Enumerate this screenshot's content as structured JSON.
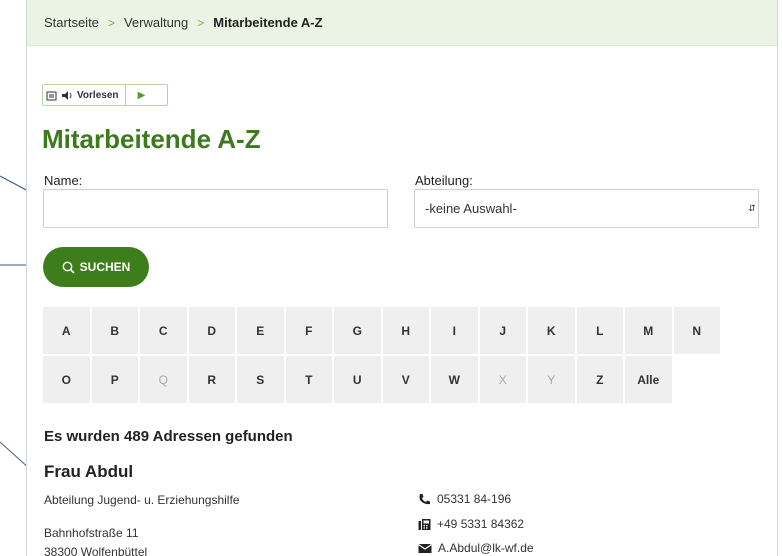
{
  "breadcrumb": {
    "items": [
      "Startseite",
      "Verwaltung"
    ],
    "current": "Mitarbeitende A-Z",
    "separator": ">"
  },
  "readspeaker": {
    "label": "Vorlesen",
    "play_icon": "play-icon"
  },
  "page": {
    "title": "Mitarbeitende A-Z"
  },
  "form": {
    "name_label": "Name:",
    "name_value": "",
    "department_label": "Abteilung:",
    "department_selected": "-keine Auswahl-",
    "search_label": "SUCHEN"
  },
  "alphabet": [
    {
      "label": "A",
      "enabled": true
    },
    {
      "label": "B",
      "enabled": true
    },
    {
      "label": "C",
      "enabled": true
    },
    {
      "label": "D",
      "enabled": true
    },
    {
      "label": "E",
      "enabled": true
    },
    {
      "label": "F",
      "enabled": true
    },
    {
      "label": "G",
      "enabled": true
    },
    {
      "label": "H",
      "enabled": true
    },
    {
      "label": "I",
      "enabled": true
    },
    {
      "label": "J",
      "enabled": true
    },
    {
      "label": "K",
      "enabled": true
    },
    {
      "label": "L",
      "enabled": true
    },
    {
      "label": "M",
      "enabled": true
    },
    {
      "label": "N",
      "enabled": true
    },
    {
      "label": "O",
      "enabled": true
    },
    {
      "label": "P",
      "enabled": true
    },
    {
      "label": "Q",
      "enabled": false
    },
    {
      "label": "R",
      "enabled": true
    },
    {
      "label": "S",
      "enabled": true
    },
    {
      "label": "T",
      "enabled": true
    },
    {
      "label": "U",
      "enabled": true
    },
    {
      "label": "V",
      "enabled": true
    },
    {
      "label": "W",
      "enabled": true
    },
    {
      "label": "X",
      "enabled": false
    },
    {
      "label": "Y",
      "enabled": false
    },
    {
      "label": "Z",
      "enabled": true
    },
    {
      "label": "Alle",
      "enabled": true
    }
  ],
  "results": {
    "count_text": "Es wurden 489 Adressen gefunden",
    "first": {
      "name": "Frau Abdul",
      "department": "Abteilung Jugend- u. Erziehungshilfe",
      "street": "Bahnhofstraße 11",
      "city": "38300 Wolfenbüttel",
      "phone": "05331 84-196",
      "fax": "+49 5331 84362",
      "email": "A.Abdul@lk-wf.de"
    }
  },
  "colors": {
    "brand_green": "#3e7d1c",
    "breadcrumb_bg": "#eaf3e4",
    "cell_bg": "#efefef"
  }
}
